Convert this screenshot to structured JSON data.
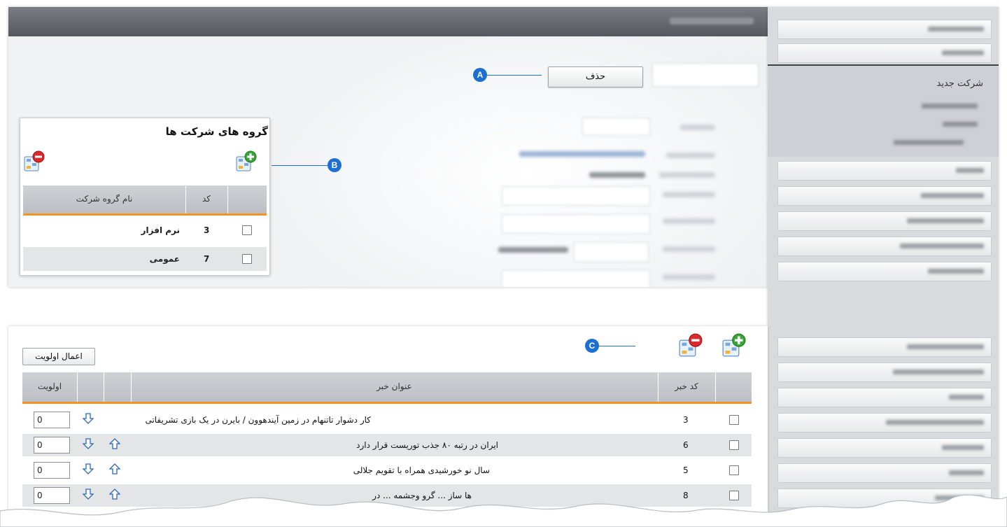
{
  "top": {
    "delete_label": "حذف"
  },
  "sidebar": {
    "active_label": "شرکت جدید"
  },
  "callouts": {
    "a": "A",
    "b": "B",
    "c": "C"
  },
  "groups_panel": {
    "title": "گروه های شرکت ها",
    "columns": {
      "code": "کد",
      "name": "نام گروه شرکت"
    },
    "rows": [
      {
        "code": "3",
        "name": "نرم افزار"
      },
      {
        "code": "7",
        "name": "عمومی"
      }
    ]
  },
  "news_panel": {
    "apply_label": "اعمال اولویت",
    "columns": {
      "code": "کد خبر",
      "title": "عنوان خبر",
      "priority": "اولویت"
    },
    "rows": [
      {
        "code": "3",
        "title": "کار دشوار تاتنهام در زمین آیندهوون / بایرن در یک بازی تشریفاتی",
        "priority": "0"
      },
      {
        "code": "6",
        "title": "ایران در رتبه ۸۰ جذب توریست قرار دارد",
        "priority": "0"
      },
      {
        "code": "5",
        "title": "سال نو خورشیدی همراه با تقویم جلالی",
        "priority": "0"
      },
      {
        "code": "8",
        "title": "ها ساز ... گرو وجشمه ... در",
        "priority": "0"
      }
    ]
  },
  "colors": {
    "accent": "#f19422",
    "callout": "#1d6fd0",
    "header_bar": "#55585e"
  }
}
